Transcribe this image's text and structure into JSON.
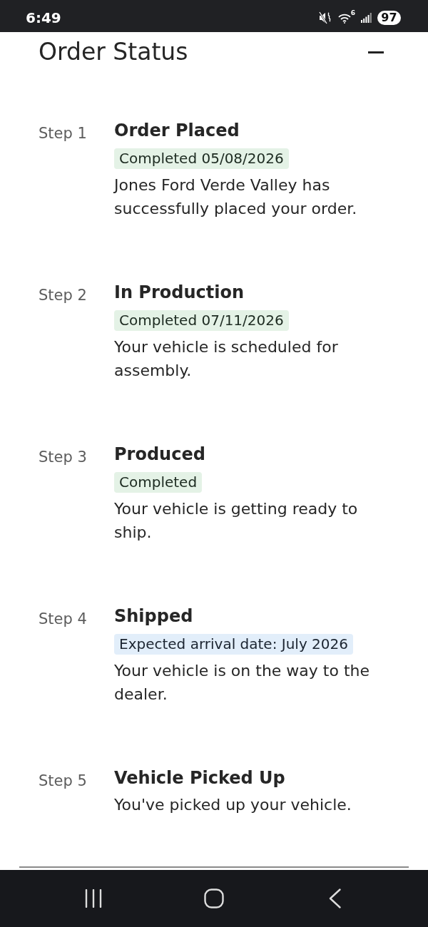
{
  "status_bar": {
    "time": "6:49",
    "wifi_label": "6",
    "battery": "97"
  },
  "header": {
    "title": "Order Status"
  },
  "steps": [
    {
      "label": "Step 1",
      "title": "Order Placed",
      "badge": {
        "kind": "completed",
        "text": "Completed 05/08/2026"
      },
      "description": "Jones Ford Verde Valley has successfully placed your order."
    },
    {
      "label": "Step 2",
      "title": "In Production",
      "badge": {
        "kind": "completed",
        "text": "Completed 07/11/2026"
      },
      "description": "Your vehicle is scheduled for assembly."
    },
    {
      "label": "Step 3",
      "title": "Produced",
      "badge": {
        "kind": "completed",
        "text": "Completed"
      },
      "description": "Your vehicle is getting ready to ship."
    },
    {
      "label": "Step 4",
      "title": "Shipped",
      "badge": {
        "kind": "expected",
        "text": "Expected arrival date: July 2026"
      },
      "description": "Your vehicle is on the way to the dealer."
    },
    {
      "label": "Step 5",
      "title": "Vehicle Picked Up",
      "description": "You've picked up your vehicle."
    }
  ]
}
